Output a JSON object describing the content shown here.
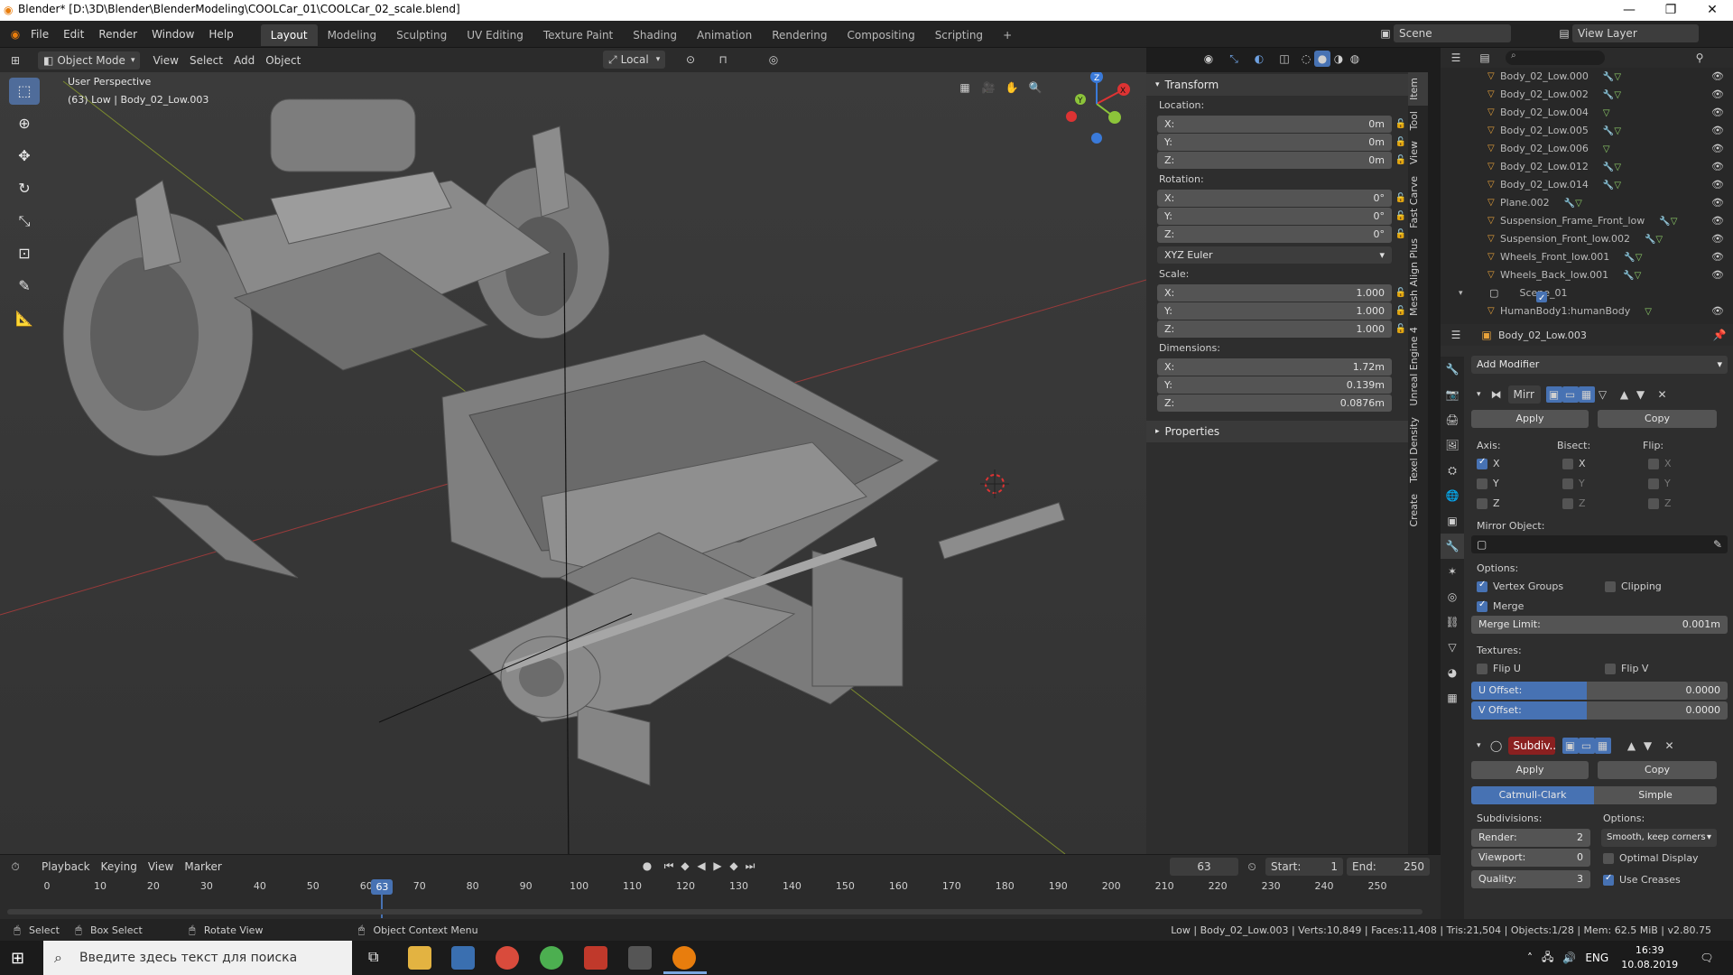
{
  "window": {
    "title": "Blender* [D:\\3D\\Blender\\BlenderModeling\\COOLCar_01\\COOLCar_02_scale.blend]",
    "controls": [
      "—",
      "❐",
      "✕"
    ]
  },
  "menu": {
    "items": [
      "File",
      "Edit",
      "Render",
      "Window",
      "Help"
    ],
    "workspaces": [
      "Layout",
      "Modeling",
      "Sculpting",
      "UV Editing",
      "Texture Paint",
      "Shading",
      "Animation",
      "Rendering",
      "Compositing",
      "Scripting"
    ],
    "active_workspace": "Layout",
    "add_tab": "+",
    "scene_label": "Scene",
    "view_layer_label": "View Layer"
  },
  "viewport_header": {
    "mode": "Object Mode",
    "menus": [
      "View",
      "Select",
      "Add",
      "Object"
    ],
    "orientation": "Local"
  },
  "viewport": {
    "perspective_label": "User Perspective",
    "object_label": "(63) Low | Body_02_Low.003",
    "gizmo_axes": [
      "X",
      "Y",
      "Z"
    ]
  },
  "transform": {
    "header": "Transform",
    "location_label": "Location:",
    "location": [
      {
        "axis": "X:",
        "value": "0m"
      },
      {
        "axis": "Y:",
        "value": "0m"
      },
      {
        "axis": "Z:",
        "value": "0m"
      }
    ],
    "rotation_label": "Rotation:",
    "rotation": [
      {
        "axis": "X:",
        "value": "0°"
      },
      {
        "axis": "Y:",
        "value": "0°"
      },
      {
        "axis": "Z:",
        "value": "0°"
      }
    ],
    "rotation_mode": "XYZ Euler",
    "scale_label": "Scale:",
    "scale": [
      {
        "axis": "X:",
        "value": "1.000"
      },
      {
        "axis": "Y:",
        "value": "1.000"
      },
      {
        "axis": "Z:",
        "value": "1.000"
      }
    ],
    "dimensions_label": "Dimensions:",
    "dimensions": [
      {
        "axis": "X:",
        "value": "1.72m"
      },
      {
        "axis": "Y:",
        "value": "0.139m"
      },
      {
        "axis": "Z:",
        "value": "0.0876m"
      }
    ],
    "properties_header": "Properties"
  },
  "side_tabs": [
    "Item",
    "Tool",
    "View",
    "Fast Carve",
    "Mesh Align Plus",
    "Unreal Engine 4",
    "Texel Density",
    "Create"
  ],
  "outliner": {
    "items": [
      "Body_02_Low.000",
      "Body_02_Low.002",
      "Body_02_Low.004",
      "Body_02_Low.005",
      "Body_02_Low.006",
      "Body_02_Low.012",
      "Body_02_Low.014",
      "Plane.002",
      "Suspension_Frame_Front_low",
      "Suspension_Front_low.002",
      "Wheels_Front_low.001",
      "Wheels_Back_low.001"
    ],
    "collection": "Scene_01",
    "collection_child": "HumanBody1:humanBody"
  },
  "properties": {
    "object_name": "Body_02_Low.003",
    "add_modifier": "Add Modifier",
    "mirror": {
      "name": "Mirr",
      "apply": "Apply",
      "copy": "Copy",
      "axis_label": "Axis:",
      "bisect_label": "Bisect:",
      "flip_label": "Flip:",
      "axes": [
        "X",
        "Y",
        "Z"
      ],
      "axis_checked": [
        true,
        false,
        false
      ],
      "mirror_object_label": "Mirror Object:",
      "options_label": "Options:",
      "vertex_groups": "Vertex Groups",
      "clipping": "Clipping",
      "merge": "Merge",
      "merge_limit_label": "Merge Limit:",
      "merge_limit": "0.001m",
      "textures_label": "Textures:",
      "flip_u": "Flip U",
      "flip_v": "Flip V",
      "u_offset_label": "U Offset:",
      "u_offset": "0.0000",
      "v_offset_label": "V Offset:",
      "v_offset": "0.0000"
    },
    "subdiv": {
      "name": "Subdiv..",
      "apply": "Apply",
      "copy": "Copy",
      "catmull": "Catmull-Clark",
      "simple": "Simple",
      "subdivisions_label": "Subdivisions:",
      "options_label": "Options:",
      "render_label": "Render:",
      "render": "2",
      "viewport_label": "Viewport:",
      "viewport": "0",
      "quality_label": "Quality:",
      "quality": "3",
      "uv_smooth": "Smooth, keep corners",
      "optimal_display": "Optimal Display",
      "use_creases": "Use Creases"
    }
  },
  "timeline": {
    "menus": [
      "Playback",
      "Keying",
      "View",
      "Marker"
    ],
    "current_frame": "63",
    "start_label": "Start:",
    "start": "1",
    "end_label": "End:",
    "end": "250",
    "ticks": [
      "0",
      "10",
      "20",
      "30",
      "40",
      "50",
      "60",
      "70",
      "80",
      "90",
      "100",
      "110",
      "120",
      "130",
      "140",
      "150",
      "160",
      "170",
      "180",
      "190",
      "200",
      "210",
      "220",
      "230",
      "240",
      "250"
    ]
  },
  "status": {
    "select": "Select",
    "box_select": "Box Select",
    "rotate_view": "Rotate View",
    "context_menu": "Object Context Menu",
    "stats": "Low | Body_02_Low.003 | Verts:10,849 | Faces:11,408 | Tris:21,504 | Objects:1/28 | Mem: 62.5 MiB | v2.80.75"
  },
  "taskbar": {
    "search_placeholder": "Введите здесь текст для поиска",
    "lang": "ENG",
    "time": "16:39",
    "date": "10.08.2019"
  }
}
